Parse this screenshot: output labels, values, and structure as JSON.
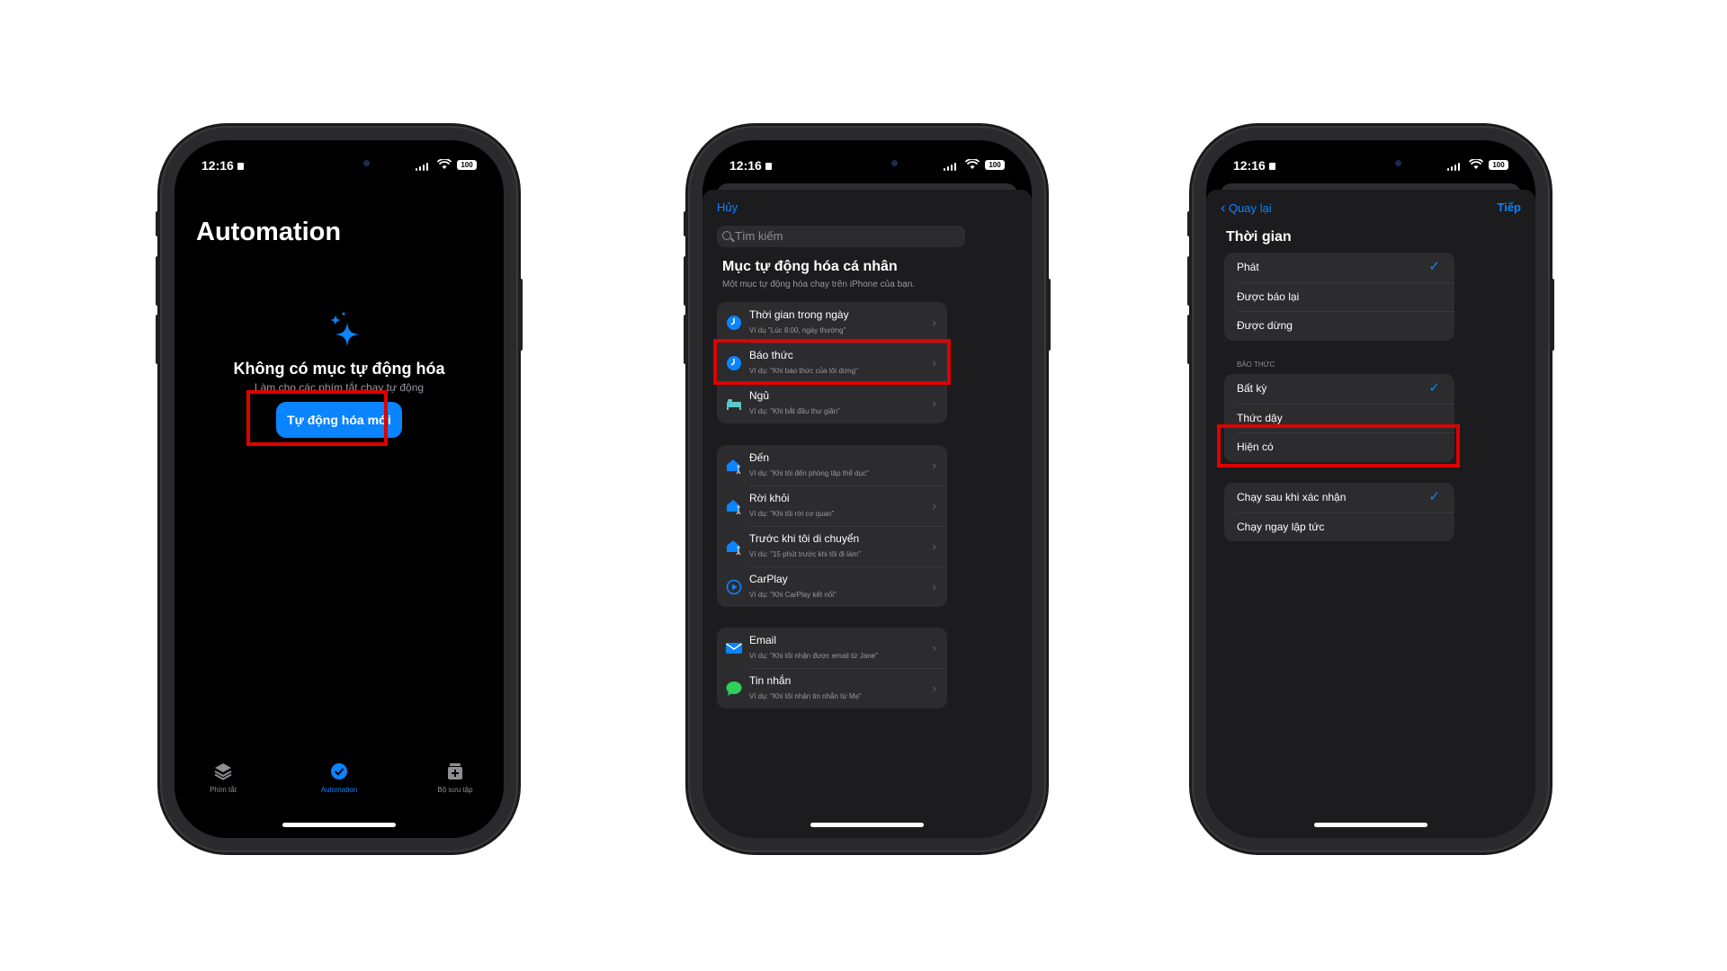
{
  "status": {
    "time": "12:16",
    "battery": "100"
  },
  "phone1": {
    "title": "Automation",
    "empty_title": "Không có mục tự động hóa",
    "empty_sub": "Làm cho các phím tắt chạy tự động",
    "new_button": "Tự động hóa mới",
    "tabs": [
      {
        "label": "Phím tắt",
        "icon": "layers-icon"
      },
      {
        "label": "Automation",
        "icon": "automation-check-icon"
      },
      {
        "label": "Bộ sưu tập",
        "icon": "gallery-icon"
      }
    ]
  },
  "phone2": {
    "cancel": "Hủy",
    "search_placeholder": "Tìm kiếm",
    "section_title": "Mục tự động hóa cá nhân",
    "section_sub": "Một mục tự động hóa chạy trên iPhone của bạn.",
    "group1": [
      {
        "title": "Thời gian trong ngày",
        "sub": "Ví dụ \"Lúc 8:00, ngày thường\"",
        "icon": "clock-icon"
      },
      {
        "title": "Báo thức",
        "sub": "Ví dụ: \"Khi báo thức của tôi dừng\"",
        "icon": "alarm-clock-icon"
      },
      {
        "title": "Ngủ",
        "sub": "Ví dụ: \"Khi bắt đầu thư giãn\"",
        "icon": "bed-icon"
      }
    ],
    "group2": [
      {
        "title": "Đến",
        "sub": "Ví dụ: \"Khi tôi đến phòng tập thể dục\"",
        "icon": "arrive-icon"
      },
      {
        "title": "Rời khỏi",
        "sub": "Ví dụ: \"Khi tôi rời cơ quan\"",
        "icon": "leave-icon"
      },
      {
        "title": "Trước khi tôi di chuyển",
        "sub": "Ví dụ: \"15 phút trước khi tôi đi làm\"",
        "icon": "commute-icon"
      },
      {
        "title": "CarPlay",
        "sub": "Ví dụ: \"Khi CarPlay kết nối\"",
        "icon": "carplay-icon"
      }
    ],
    "group3": [
      {
        "title": "Email",
        "sub": "Ví dụ: \"Khi tôi nhận được email từ Jane\"",
        "icon": "mail-icon"
      },
      {
        "title": "Tin nhắn",
        "sub": "Ví dụ: \"Khi tôi nhận tin nhắn từ Mẹ\"",
        "icon": "message-icon"
      }
    ]
  },
  "phone3": {
    "back": "Quay lại",
    "next": "Tiếp",
    "title": "Thời gian",
    "time_options": [
      {
        "label": "Phát",
        "checked": true
      },
      {
        "label": "Được báo lại",
        "checked": false
      },
      {
        "label": "Được dừng",
        "checked": false
      }
    ],
    "alarm_caption": "BÁO THỨC",
    "alarm_options": [
      {
        "label": "Bất kỳ",
        "checked": true
      },
      {
        "label": "Thức dậy",
        "checked": false
      },
      {
        "label": "Hiện có",
        "checked": false
      }
    ],
    "run_options": [
      {
        "label": "Chạy sau khi xác nhận",
        "checked": true
      },
      {
        "label": "Chạy ngay lập tức",
        "checked": false
      }
    ],
    "check_glyph": "✓"
  },
  "colors": {
    "accent": "#0a84ff",
    "highlight": "#e00000"
  }
}
